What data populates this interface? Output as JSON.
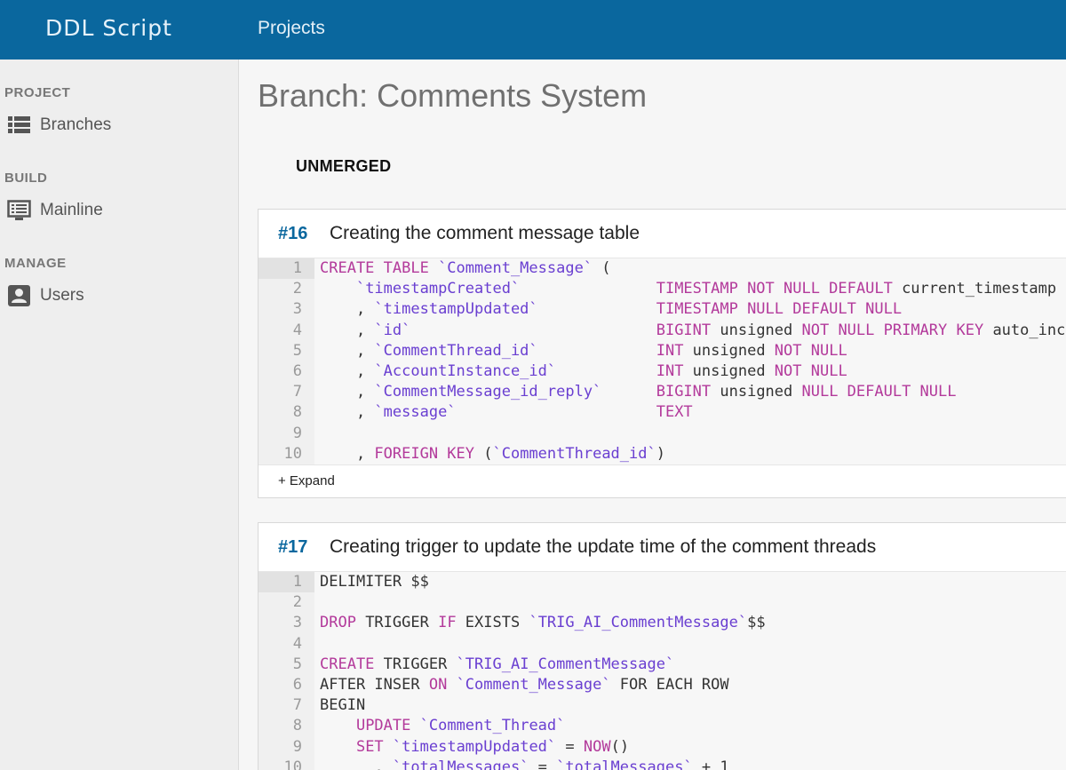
{
  "header": {
    "logo": "DDL Script",
    "nav_projects": "Projects"
  },
  "sidebar": {
    "sections": [
      {
        "title": "PROJECT",
        "items": [
          {
            "label": "Branches",
            "icon": "list-icon"
          }
        ]
      },
      {
        "title": "BUILD",
        "items": [
          {
            "label": "Mainline",
            "icon": "monitor-icon"
          }
        ]
      },
      {
        "title": "MANAGE",
        "items": [
          {
            "label": "Users",
            "icon": "user-icon"
          }
        ]
      }
    ]
  },
  "page": {
    "title": "Branch: Comments System",
    "status": "UNMERGED"
  },
  "colors": {
    "header_bg": "#0a679e",
    "accent": "#0a679e",
    "keyword": "#b33a9b",
    "string": "#6a3fd1"
  },
  "scripts": [
    {
      "number": "#16",
      "title": "Creating the comment message table",
      "expand_label": "+ Expand",
      "lines": [
        [
          [
            "CREATE TABLE ",
            "kw"
          ],
          [
            "`Comment_Message`",
            "str"
          ],
          [
            " (",
            ""
          ]
        ],
        [
          [
            "    ",
            ""
          ],
          [
            "`timestampCreated`",
            "str"
          ],
          [
            "               ",
            ""
          ],
          [
            "TIMESTAMP NOT NULL DEFAULT ",
            "kw"
          ],
          [
            "current_timestamp",
            ""
          ]
        ],
        [
          [
            "    , ",
            ""
          ],
          [
            "`timestampUpdated`",
            "str"
          ],
          [
            "             ",
            ""
          ],
          [
            "TIMESTAMP NULL DEFAULT NULL",
            "kw"
          ]
        ],
        [
          [
            "    , ",
            ""
          ],
          [
            "`id`",
            "str"
          ],
          [
            "                           ",
            ""
          ],
          [
            "BIGINT",
            "kw"
          ],
          [
            " unsigned ",
            ""
          ],
          [
            "NOT NULL PRIMARY KEY",
            "kw"
          ],
          [
            " auto_increment",
            ""
          ]
        ],
        [
          [
            "    , ",
            ""
          ],
          [
            "`CommentThread_id`",
            "str"
          ],
          [
            "             ",
            ""
          ],
          [
            "INT",
            "kw"
          ],
          [
            " unsigned ",
            ""
          ],
          [
            "NOT NULL",
            "kw"
          ]
        ],
        [
          [
            "    , ",
            ""
          ],
          [
            "`AccountInstance_id`",
            "str"
          ],
          [
            "           ",
            ""
          ],
          [
            "INT",
            "kw"
          ],
          [
            " unsigned ",
            ""
          ],
          [
            "NOT NULL",
            "kw"
          ]
        ],
        [
          [
            "    , ",
            ""
          ],
          [
            "`CommentMessage_id_reply`",
            "str"
          ],
          [
            "      ",
            ""
          ],
          [
            "BIGINT",
            "kw"
          ],
          [
            " unsigned ",
            ""
          ],
          [
            "NULL DEFAULT NULL",
            "kw"
          ]
        ],
        [
          [
            "    , ",
            ""
          ],
          [
            "`message`",
            "str"
          ],
          [
            "                      ",
            ""
          ],
          [
            "TEXT",
            "kw"
          ]
        ],
        [
          [
            "",
            ""
          ]
        ],
        [
          [
            "    , ",
            ""
          ],
          [
            "FOREIGN KEY",
            "kw"
          ],
          [
            " (",
            ""
          ],
          [
            "`CommentThread_id`",
            "str"
          ],
          [
            ")",
            ""
          ]
        ]
      ]
    },
    {
      "number": "#17",
      "title": "Creating trigger to update the update time of the comment threads",
      "expand_label": "",
      "lines": [
        [
          [
            "DELIMITER $$",
            ""
          ]
        ],
        [
          [
            "",
            ""
          ]
        ],
        [
          [
            "DROP",
            "kw"
          ],
          [
            " TRIGGER ",
            ""
          ],
          [
            "IF",
            "kw"
          ],
          [
            " EXISTS ",
            ""
          ],
          [
            "`TRIG_AI_CommentMessage`",
            "str"
          ],
          [
            "$$",
            ""
          ]
        ],
        [
          [
            "",
            ""
          ]
        ],
        [
          [
            "CREATE",
            "kw"
          ],
          [
            " TRIGGER ",
            ""
          ],
          [
            "`TRIG_AI_CommentMessage`",
            "str"
          ]
        ],
        [
          [
            "AFTER INSER ",
            ""
          ],
          [
            "ON",
            "kw"
          ],
          [
            " ",
            ""
          ],
          [
            "`Comment_Message`",
            "str"
          ],
          [
            " FOR EACH ROW",
            ""
          ]
        ],
        [
          [
            "BEGIN",
            ""
          ]
        ],
        [
          [
            "    ",
            ""
          ],
          [
            "UPDATE",
            "kw"
          ],
          [
            " ",
            ""
          ],
          [
            "`Comment_Thread`",
            "str"
          ]
        ],
        [
          [
            "    ",
            ""
          ],
          [
            "SET",
            "kw"
          ],
          [
            " ",
            ""
          ],
          [
            "`timestampUpdated`",
            "str"
          ],
          [
            " = ",
            ""
          ],
          [
            "NOW",
            "kw"
          ],
          [
            "()",
            ""
          ]
        ],
        [
          [
            "      , ",
            ""
          ],
          [
            "`totalMessages`",
            "str"
          ],
          [
            " = ",
            ""
          ],
          [
            "`totalMessages`",
            "str"
          ],
          [
            " + 1",
            ""
          ]
        ]
      ]
    }
  ]
}
